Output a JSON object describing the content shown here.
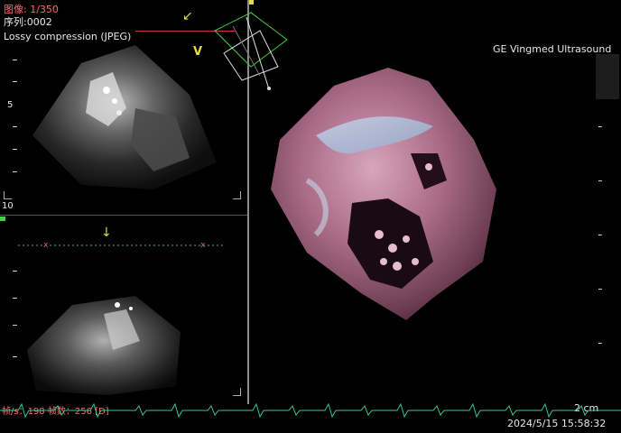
{
  "overlay": {
    "image_counter": "图像: 1/350",
    "series": "序列:0002",
    "compression": "Lossy compression (JPEG)",
    "vendor": "GE Vingmed Ultrasound",
    "plane_marker": "V",
    "depth_labels": [
      "5",
      "10"
    ],
    "footer_left": "帧/s：198 帧数：256 [D]",
    "scale_label": "2 cm",
    "timestamp": "2024/5/15 15:58:32"
  },
  "colors": {
    "ecg": "#2ecc9a",
    "text_red": "#ff6a6a",
    "marker_yellow": "#e6d94a",
    "orientation_green": "#3fd13f",
    "tissue": "#b07a90"
  }
}
